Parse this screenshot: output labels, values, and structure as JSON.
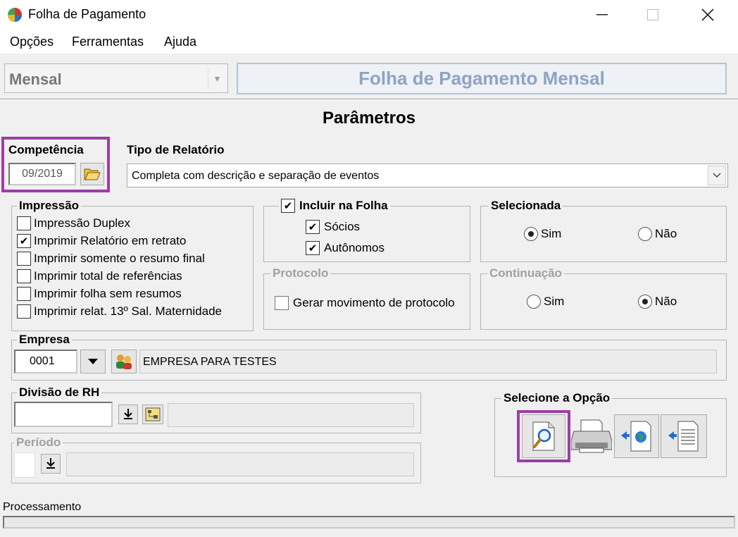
{
  "window": {
    "title": "Folha de Pagamento"
  },
  "menu": {
    "opcoes": "Opções",
    "ferramentas": "Ferramentas",
    "ajuda": "Ajuda"
  },
  "header": {
    "mode": "Mensal",
    "banner": "Folha de Pagamento Mensal"
  },
  "params_title": "Parâmetros",
  "competencia": {
    "label": "Competência",
    "value": "09/2019"
  },
  "tipo_relatorio": {
    "label": "Tipo de Relatório",
    "value": "Completa com descrição e separação de eventos"
  },
  "impressao": {
    "label": "Impressão",
    "items": [
      {
        "label": "Impressão Duplex",
        "checked": false
      },
      {
        "label": "Imprimir Relatório em retrato",
        "checked": true
      },
      {
        "label": "Imprimir somente o resumo final",
        "checked": false
      },
      {
        "label": "Imprimir total de referências",
        "checked": false
      },
      {
        "label": "Imprimir folha sem resumos",
        "checked": false
      },
      {
        "label": "Imprimir relat. 13º Sal. Maternidade",
        "checked": false
      }
    ]
  },
  "incluir": {
    "label": "Incluir na Folha",
    "checked": true,
    "socios": "Sócios",
    "autonomos": "Autônomos"
  },
  "selecionada": {
    "label": "Selecionada",
    "sim": "Sim",
    "nao": "Não",
    "selected": "Sim"
  },
  "protocolo": {
    "label": "Protocolo",
    "gerar": "Gerar movimento de protocolo"
  },
  "continuacao": {
    "label": "Continuação",
    "sim": "Sim",
    "nao": "Não",
    "selected": "Não"
  },
  "empresa": {
    "label": "Empresa",
    "code": "0001",
    "name": "EMPRESA PARA TESTES"
  },
  "divisao": {
    "label": "Divisão de RH",
    "value": ""
  },
  "periodo": {
    "label": "Período"
  },
  "selecione": {
    "label": "Selecione a Opção"
  },
  "status": {
    "label": "Processamento"
  },
  "colors": {
    "highlight": "#9b3fa7",
    "banner_text": "#8fa3c4"
  }
}
